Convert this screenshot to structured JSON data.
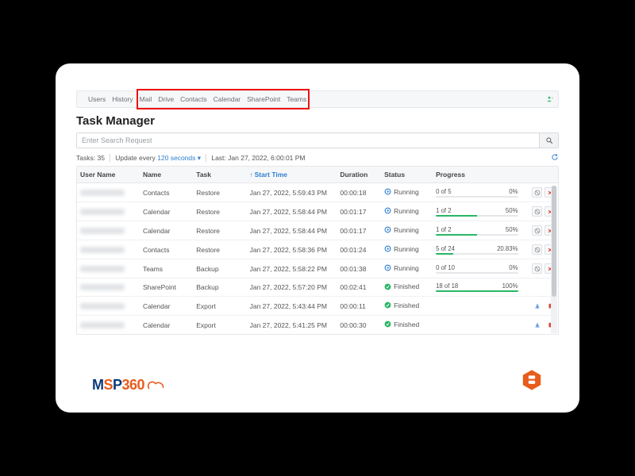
{
  "nav": {
    "items": [
      "Users",
      "History",
      "Mail",
      "Drive",
      "Contacts",
      "Calendar",
      "SharePoint",
      "Teams"
    ],
    "highlight_start_index": 2,
    "highlight_end_index": 7
  },
  "title": "Task Manager",
  "search": {
    "placeholder": "Enter Search Request"
  },
  "meta": {
    "tasks_label": "Tasks:",
    "tasks_count": "35",
    "update_label": "Update every",
    "update_interval": "120 seconds",
    "last_label": "Last:",
    "last_time": "Jan 27, 2022, 6:00:01 PM"
  },
  "columns": {
    "user": "User Name",
    "name": "Name",
    "task": "Task",
    "start": "Start Time",
    "duration": "Duration",
    "status": "Status",
    "progress": "Progress"
  },
  "status_labels": {
    "running": "Running",
    "finished": "Finished"
  },
  "rows": [
    {
      "name": "Contacts",
      "task": "Restore",
      "start": "Jan 27, 2022, 5:59:43 PM",
      "duration": "00:00:18",
      "status": "running",
      "progress_text": "0 of 5",
      "progress_pct": "0%",
      "progress_val": 0,
      "action": "cancel"
    },
    {
      "name": "Calendar",
      "task": "Restore",
      "start": "Jan 27, 2022, 5:58:44 PM",
      "duration": "00:01:17",
      "status": "running",
      "progress_text": "1 of 2",
      "progress_pct": "50%",
      "progress_val": 50,
      "action": "cancel"
    },
    {
      "name": "Calendar",
      "task": "Restore",
      "start": "Jan 27, 2022, 5:58:44 PM",
      "duration": "00:01:17",
      "status": "running",
      "progress_text": "1 of 2",
      "progress_pct": "50%",
      "progress_val": 50,
      "action": "cancel"
    },
    {
      "name": "Contacts",
      "task": "Restore",
      "start": "Jan 27, 2022, 5:58:36 PM",
      "duration": "00:01:24",
      "status": "running",
      "progress_text": "5 of 24",
      "progress_pct": "20.83%",
      "progress_val": 20.83,
      "action": "cancel"
    },
    {
      "name": "Teams",
      "task": "Backup",
      "start": "Jan 27, 2022, 5:58:22 PM",
      "duration": "00:01:38",
      "status": "running",
      "progress_text": "0 of 10",
      "progress_pct": "0%",
      "progress_val": 0,
      "action": "cancel"
    },
    {
      "name": "SharePoint",
      "task": "Backup",
      "start": "Jan 27, 2022, 5:57:20 PM",
      "duration": "00:02:41",
      "status": "finished",
      "progress_text": "18 of 18",
      "progress_pct": "100%",
      "progress_val": 100,
      "action": "none"
    },
    {
      "name": "Calendar",
      "task": "Export",
      "start": "Jan 27, 2022, 5:43:44 PM",
      "duration": "00:00:11",
      "status": "finished",
      "action": "download"
    },
    {
      "name": "Calendar",
      "task": "Export",
      "start": "Jan 27, 2022, 5:41:25 PM",
      "duration": "00:00:30",
      "status": "finished",
      "action": "download"
    }
  ],
  "brand": {
    "left": "MSP360"
  }
}
